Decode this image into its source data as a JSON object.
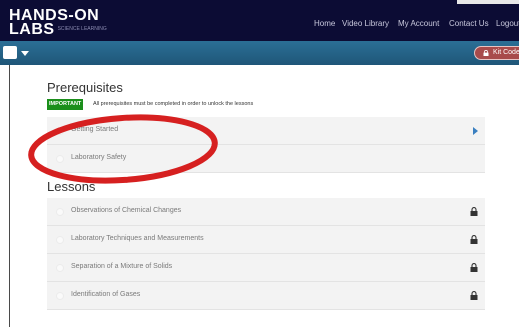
{
  "header": {
    "logo_line1": "HANDS-ON",
    "logo_line2": "LABS",
    "logo_tagline": "SCIENCE LEARNING",
    "nav": [
      "Home",
      "Video Library",
      "My Account",
      "Contact Us",
      "Logout"
    ]
  },
  "toolbar": {
    "kit_code_label": "Kit Code"
  },
  "prerequisites": {
    "title": "Prerequisites",
    "important_badge": "IMPORTANT",
    "important_text": "All prerequisites must be completed in order to unlock the lessons",
    "items": [
      {
        "label": "Getting Started",
        "status": "play"
      },
      {
        "label": "Laboratory Safety",
        "status": "none"
      }
    ]
  },
  "lessons": {
    "title": "Lessons",
    "items": [
      {
        "label": "Observations of Chemical Changes",
        "status": "locked"
      },
      {
        "label": "Laboratory Techniques and Measurements",
        "status": "locked"
      },
      {
        "label": "Separation of a Mixture of Solids",
        "status": "locked"
      },
      {
        "label": "Identification of Gases",
        "status": "locked"
      }
    ]
  },
  "colors": {
    "header_bg": "#0c0c34",
    "subbar_bg": "#2b6f96",
    "important_green": "#1b8f1b",
    "annotation_red": "#d62020",
    "play_blue": "#3a7fc0"
  },
  "icons": {
    "menu": "menu-square-icon",
    "kit_lock": "lock-icon",
    "row_play": "play-icon",
    "row_lock": "lock-icon"
  }
}
